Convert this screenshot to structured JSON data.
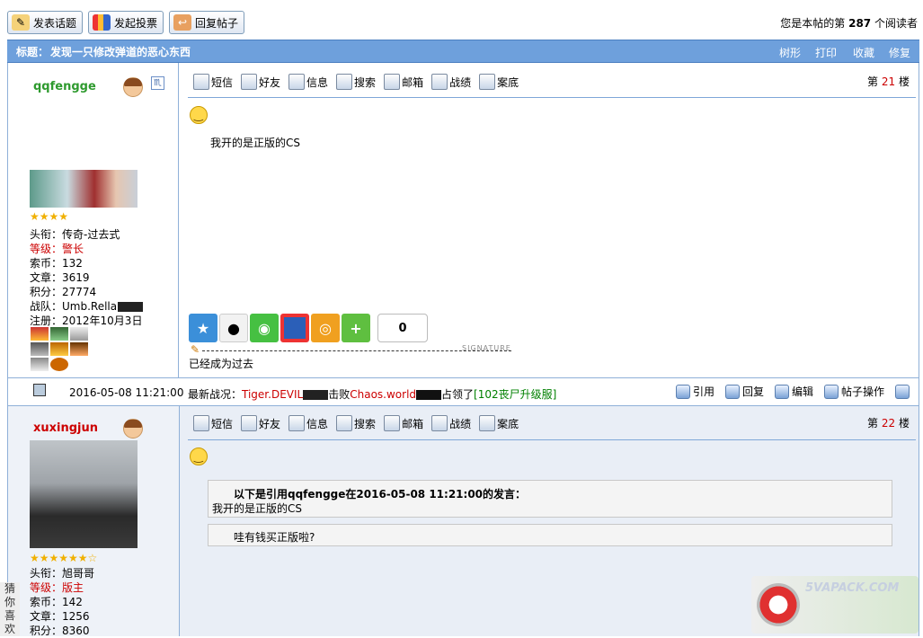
{
  "toolbar": {
    "post_topic": "发表话题",
    "start_poll": "发起投票",
    "reply_post": "回复帖子",
    "reader_prefix": "您是本帖的第",
    "reader_count": "287",
    "reader_suffix": "个阅读者"
  },
  "thread": {
    "title_label": "标题：",
    "title": "发现一只修改弹道的恶心东西",
    "actions": [
      "树形",
      "打印",
      "收藏",
      "修复"
    ]
  },
  "post_tools": [
    "短信",
    "好友",
    "信息",
    "搜索",
    "邮箱",
    "战绩",
    "案底"
  ],
  "post1": {
    "username": "qqfengge",
    "floor_prefix": "第",
    "floor": "21",
    "floor_suffix": "楼",
    "stats": {
      "title": "头衔：传奇-过去式",
      "level": "等级：警长",
      "coins": "索币：132",
      "articles": "文章：3619",
      "points": "积分：27774",
      "team": "战队：Umb.Rella",
      "registered": "注册：2012年10月3日"
    },
    "stars": "★★★★",
    "content": "我开的是正版的CS",
    "share_count": "0",
    "signature_label": "SIGNATURE",
    "signature": "已经成为过去"
  },
  "infobar": {
    "date": "2016-05-08 11:21:00",
    "news_label": "最新战况：",
    "team1": "Tiger.DEVIL",
    "verb1": "击败",
    "team2": "Chaos.world",
    "verb2": "占领了",
    "server": "[102丧尸升级服]",
    "actions": [
      "引用",
      "回复",
      "编辑",
      "帖子操作"
    ]
  },
  "post2": {
    "username": "xuxingjun",
    "floor_prefix": "第",
    "floor": "22",
    "floor_suffix": "楼",
    "stars": "★★★★★★☆",
    "stats": {
      "title": "头衔：旭哥哥",
      "level": "等级：版主",
      "coins": "索币：142",
      "articles": "文章：1256",
      "points": "积分：8360"
    },
    "quote_header": "以下是引用qqfengge在2016-05-08 11:21:00的发言：",
    "quote_body": "我开的是正版的CS",
    "reply": "哇有钱买正版啦?"
  },
  "side_tab": "猜你喜欢",
  "watermark": "5VAPACK.COM",
  "colors": {
    "title_bar": "#6ea0dc",
    "red": "#cc0000",
    "green_name": "#2e9a2e",
    "red_name": "#cc0000"
  }
}
